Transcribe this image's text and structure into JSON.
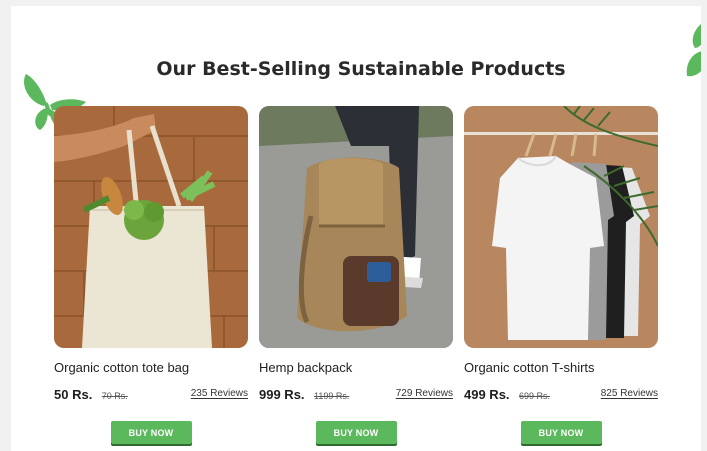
{
  "section": {
    "title": "Our Best-Selling Sustainable Products"
  },
  "colors": {
    "accent_green": "#5cb85c",
    "butterfly_green": "#5cb85c",
    "page_bg": "#ffffff"
  },
  "products": [
    {
      "name": "Organic cotton tote bag",
      "price": "50 Rs.",
      "old_price": "70 Rs.",
      "reviews": "235 Reviews",
      "button": "BUY NOW",
      "image": "tote-bag-with-vegetables"
    },
    {
      "name": "Hemp backpack",
      "price": "999 Rs.",
      "old_price": "1199 Rs.",
      "reviews": "729 Reviews",
      "button": "BUY NOW",
      "image": "hemp-backpack-on-road"
    },
    {
      "name": "Organic cotton T-shirts",
      "price": "499 Rs.",
      "old_price": "699 Rs.",
      "reviews": "825 Reviews",
      "button": "BUY NOW",
      "image": "tshirts-on-hangers"
    }
  ],
  "decorations": [
    "butterfly-icon",
    "butterfly-wing-icon"
  ]
}
